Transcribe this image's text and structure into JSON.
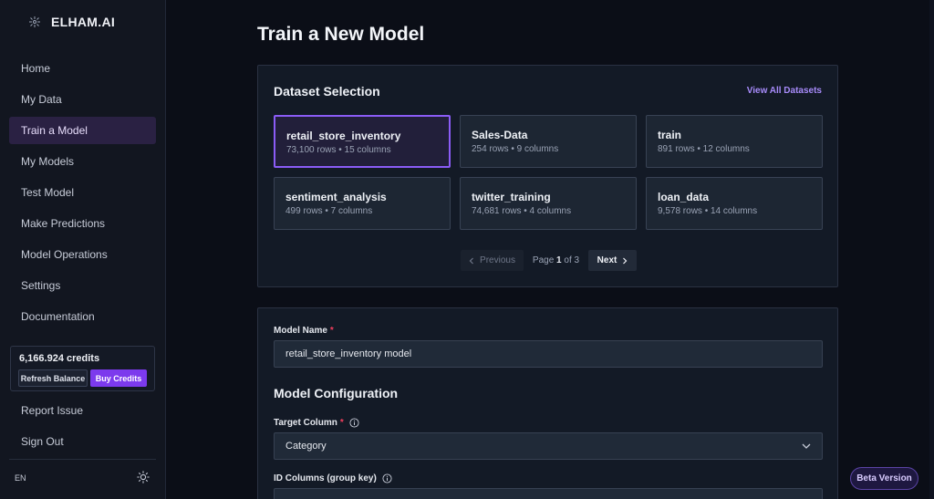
{
  "brand": {
    "name": "ELHAM.AI"
  },
  "sidebar": {
    "nav": [
      {
        "label": "Home"
      },
      {
        "label": "My Data"
      },
      {
        "label": "Train a Model",
        "active": true
      },
      {
        "label": "My Models"
      },
      {
        "label": "Test Model"
      },
      {
        "label": "Make Predictions"
      },
      {
        "label": "Model Operations"
      },
      {
        "label": "Settings"
      },
      {
        "label": "Documentation"
      }
    ],
    "credits": {
      "amount": "6,166.924 credits",
      "refresh_label": "Refresh Balance",
      "buy_label": "Buy Credits"
    },
    "nav_bottom": [
      {
        "label": "Report Issue"
      },
      {
        "label": "Sign Out"
      }
    ],
    "language": "EN",
    "theme_icon": "sun-icon"
  },
  "page": {
    "title": "Train a New Model"
  },
  "datasets": {
    "title": "Dataset Selection",
    "view_all": "View All Datasets",
    "items": [
      {
        "name": "retail_store_inventory",
        "meta": "73,100 rows • 15 columns",
        "selected": true
      },
      {
        "name": "Sales-Data",
        "meta": "254 rows • 9 columns"
      },
      {
        "name": "train",
        "meta": "891 rows • 12 columns"
      },
      {
        "name": "sentiment_analysis",
        "meta": "499 rows • 7 columns"
      },
      {
        "name": "twitter_training",
        "meta": "74,681 rows • 4 columns"
      },
      {
        "name": "loan_data",
        "meta": "9,578 rows • 14 columns"
      }
    ],
    "pager": {
      "prev": "Previous",
      "page_prefix": "Page",
      "current": "1",
      "of": "of",
      "total": "3",
      "next": "Next"
    }
  },
  "form": {
    "model_name_label": "Model Name",
    "required_mark": "*",
    "model_name_value": "retail_store_inventory model",
    "config_title": "Model Configuration",
    "target_column_label": "Target Column",
    "target_column_value": "Category",
    "id_columns_label": "ID Columns (group key)"
  },
  "beta_badge": "Beta Version",
  "colors": {
    "accent": "#8b5cf6",
    "accent_button": "#7c3aed",
    "required": "#f43f5e",
    "link": "#a78bfa"
  }
}
